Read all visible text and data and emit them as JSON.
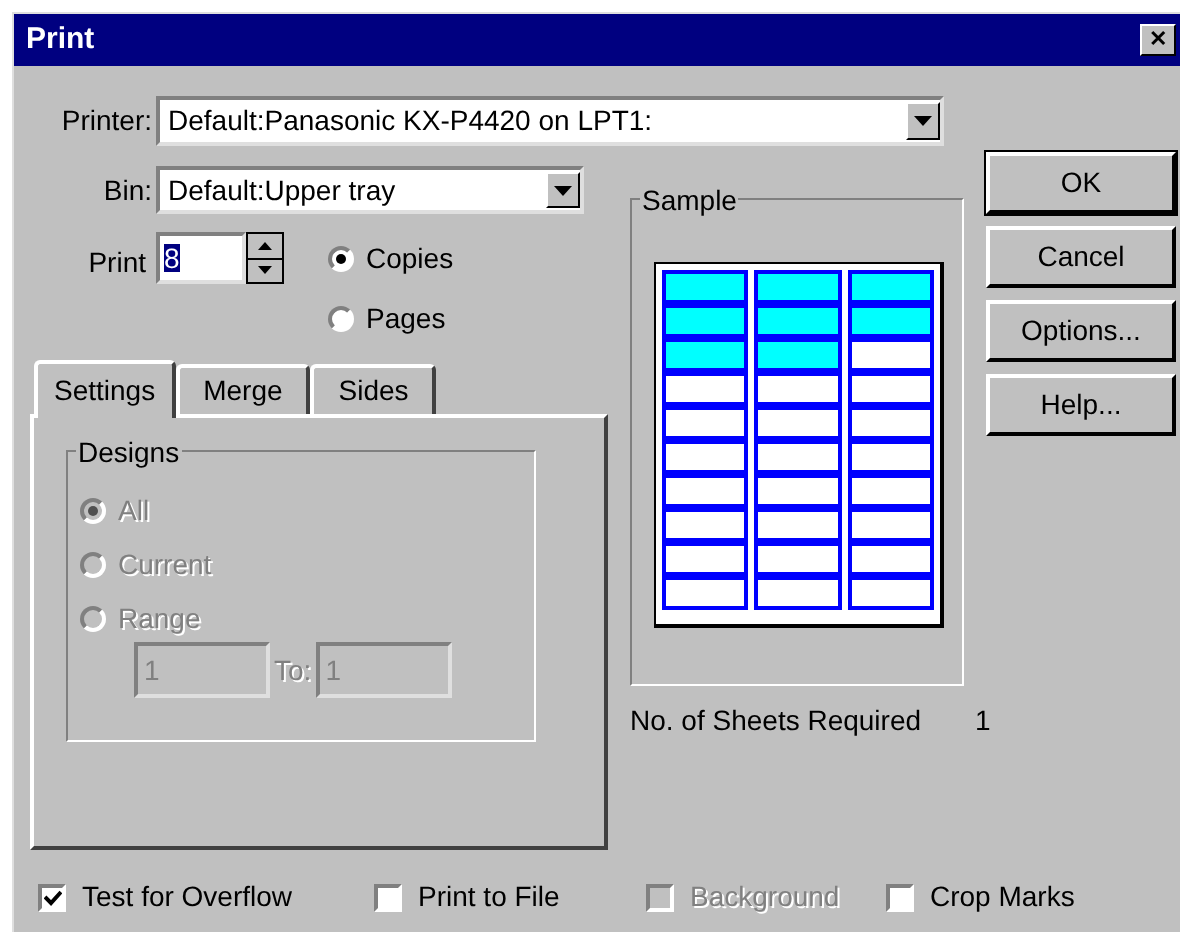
{
  "window": {
    "title": "Print",
    "close": "✕"
  },
  "printer": {
    "label": "Printer:",
    "value": "Default:Panasonic KX-P4420 on LPT1:"
  },
  "bin": {
    "label": "Bin:",
    "value": "Default:Upper tray"
  },
  "print": {
    "label": "Print",
    "value": "8"
  },
  "print_mode": [
    {
      "label": "Copies",
      "selected": true
    },
    {
      "label": "Pages",
      "selected": false
    }
  ],
  "tabs": [
    {
      "label": "Settings",
      "selected": true
    },
    {
      "label": "Merge",
      "selected": false
    },
    {
      "label": "Sides",
      "selected": false
    }
  ],
  "designs": {
    "title": "Designs",
    "options": [
      {
        "label": "All",
        "selected": true,
        "disabled": true
      },
      {
        "label": "Current",
        "selected": false,
        "disabled": true
      },
      {
        "label": "Range",
        "selected": false,
        "disabled": true
      }
    ],
    "range_from": {
      "value": "1",
      "disabled": true
    },
    "to_label": "To:",
    "range_to": {
      "value": "1",
      "disabled": true
    }
  },
  "sample": {
    "title": "Sample",
    "labels": [
      {
        "filled": true
      },
      {
        "filled": true
      },
      {
        "filled": true
      },
      {
        "filled": true
      },
      {
        "filled": true
      },
      {
        "filled": true
      },
      {
        "filled": true
      },
      {
        "filled": true
      },
      {
        "filled": false
      },
      {
        "filled": false
      },
      {
        "filled": false
      },
      {
        "filled": false
      },
      {
        "filled": false
      },
      {
        "filled": false
      },
      {
        "filled": false
      },
      {
        "filled": false
      },
      {
        "filled": false
      },
      {
        "filled": false
      },
      {
        "filled": false
      },
      {
        "filled": false
      },
      {
        "filled": false
      },
      {
        "filled": false
      },
      {
        "filled": false
      },
      {
        "filled": false
      },
      {
        "filled": false
      },
      {
        "filled": false
      },
      {
        "filled": false
      },
      {
        "filled": false
      },
      {
        "filled": false
      },
      {
        "filled": false
      }
    ]
  },
  "sheets": {
    "label": "No. of Sheets Required",
    "value": "1"
  },
  "buttons": [
    {
      "label": "OK",
      "default": true
    },
    {
      "label": "Cancel",
      "default": false
    },
    {
      "label": "Options...",
      "default": false
    },
    {
      "label": "Help...",
      "default": false
    }
  ],
  "checkboxes": [
    {
      "label": "Test for Overflow",
      "checked": true,
      "disabled": false
    },
    {
      "label": "Print to File",
      "checked": false,
      "disabled": false
    },
    {
      "label": "Background",
      "checked": false,
      "disabled": true
    },
    {
      "label": "Crop Marks",
      "checked": false,
      "disabled": false
    }
  ]
}
